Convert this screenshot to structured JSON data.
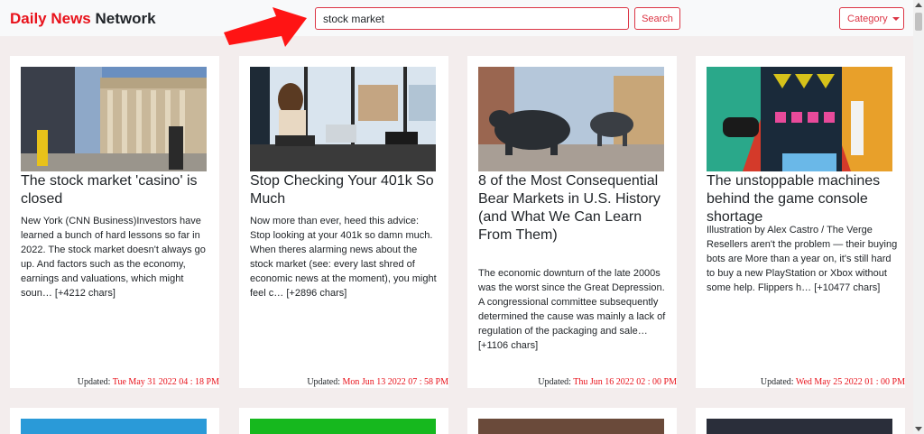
{
  "brand": {
    "part1": "Daily News",
    "part2": "Network"
  },
  "search": {
    "value": "stock market",
    "button_label": "Search"
  },
  "category": {
    "label": "Category"
  },
  "cards": [
    {
      "title": "The stock market 'casino' is closed",
      "description": "New York (CNN Business)Investors have learned a bunch of hard lessons so far in 2022. The stock market doesn't always go up. And factors such as the economy, earnings and valuations, which might soun… [+4212 chars]",
      "updated_label": "Updated:",
      "updated_date": "Tue May 31 2022 04 : 18 PM"
    },
    {
      "title": "Stop Checking Your 401k So Much",
      "description": "Now more than ever, heed this advice: Stop looking at your 401k so damn much. When theres alarming news about the stock market (see: every last shred of economic news at the moment), you might feel c… [+2896 chars]",
      "updated_label": "Updated:",
      "updated_date": "Mon Jun 13 2022 07 : 58 PM"
    },
    {
      "title": "8 of the Most Consequential Bear Markets in U.S. History (and What We Can Learn From Them)",
      "description": "The economic downturn of the late 2000s was the worst since the Great Depression. A congressional committee subsequently determined the cause was mainly a lack of regulation of the packaging and sale… [+1106 chars]",
      "updated_label": "Updated:",
      "updated_date": "Thu Jun 16 2022 02 : 00 PM"
    },
    {
      "title": "The unstoppable machines behind the game console shortage",
      "description": "Illustration by Alex Castro / The Verge Resellers aren't the problem — their buying bots are More than a year on, it's still hard to buy a new PlayStation or Xbox without some help. Flippers h… [+10477 chars]",
      "updated_label": "Updated:",
      "updated_date": "Wed May 25 2022 01 : 00 PM"
    }
  ],
  "colors": {
    "accent": "#e8121b",
    "button_border": "#dc3545",
    "background": "#f3eded"
  },
  "icons": {
    "dropdown": "caret-down-icon",
    "annotation": "red-arrow-icon"
  }
}
